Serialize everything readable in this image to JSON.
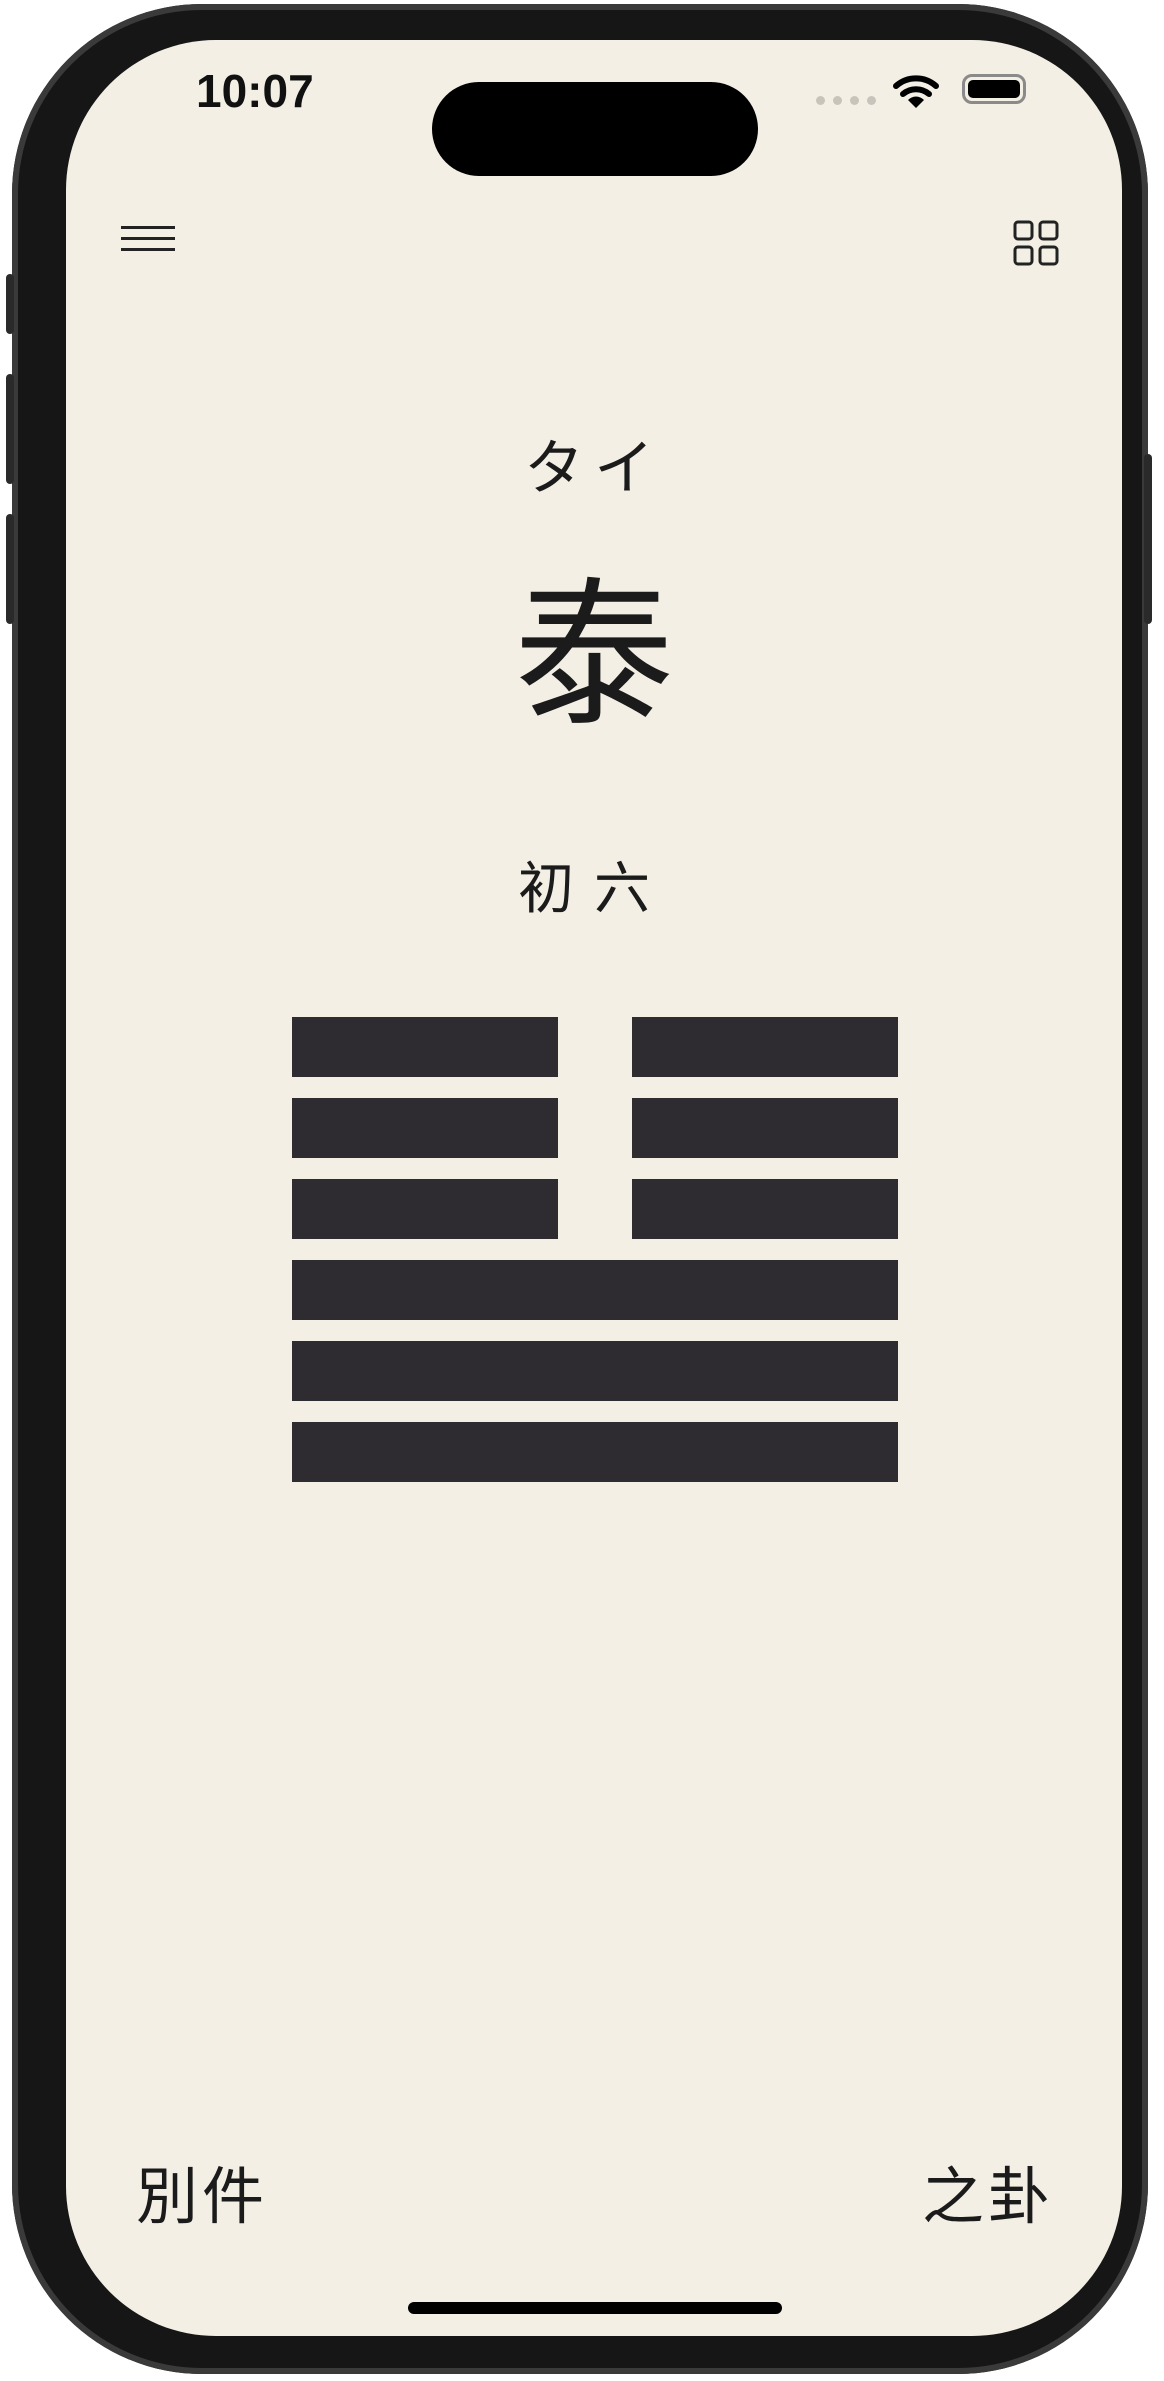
{
  "status_bar": {
    "time": "10:07"
  },
  "header": {
    "menu_icon": "hamburger-menu-icon",
    "grid_icon": "grid-view-icon"
  },
  "hexagram": {
    "reading": "タイ",
    "name": "泰",
    "line_label": "初六",
    "lines_top_to_bottom": [
      "broken",
      "broken",
      "broken",
      "solid",
      "solid",
      "solid"
    ],
    "line_color": "#2e2b31"
  },
  "footer": {
    "left_label": "別件",
    "right_label": "之卦"
  },
  "colors": {
    "background": "#f3efe4",
    "text": "#1b1b1b"
  }
}
